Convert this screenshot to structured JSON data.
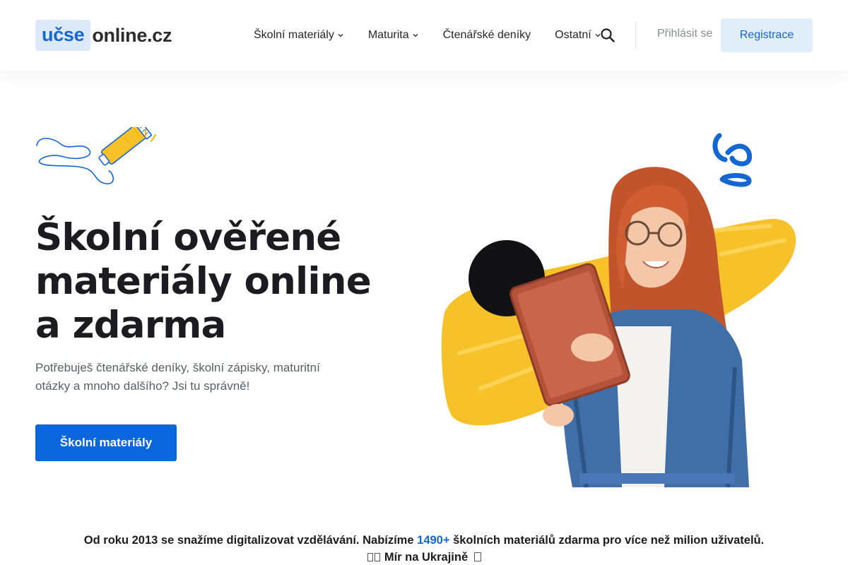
{
  "header": {
    "logo": {
      "boxed": "učse",
      "rest": "online.cz"
    },
    "nav": [
      {
        "label": "Školní materiály",
        "dropdown": true
      },
      {
        "label": "Maturita",
        "dropdown": true
      },
      {
        "label": "Čtenářské deníky",
        "dropdown": false
      },
      {
        "label": "Ostatní",
        "dropdown": true
      }
    ],
    "search_icon": "search-icon",
    "login_label": "Přihlásit se",
    "register_label": "Registrace"
  },
  "hero": {
    "title": "Školní ověřené materiály online a zdarma",
    "subtitle": "Potřebuješ čtenářské deníky, školní zápisky, maturitní otázky a mnoho dalšího? Jsi tu správně!",
    "cta_label": "Školní materiály"
  },
  "info": {
    "text_before": "Od roku 2013 se snažíme digitalizovat vzdělávání. Nabízíme",
    "count": "1490+",
    "text_after": "školních materiálů zdarma pro více než milion uživatelů.",
    "peace_text": "Mír na Ukrajině"
  },
  "colors": {
    "accent": "#0a66dd",
    "logo_bg": "#dce9f8",
    "register_bg": "#e2edfa",
    "brush_yellow": "#f7c12a"
  }
}
